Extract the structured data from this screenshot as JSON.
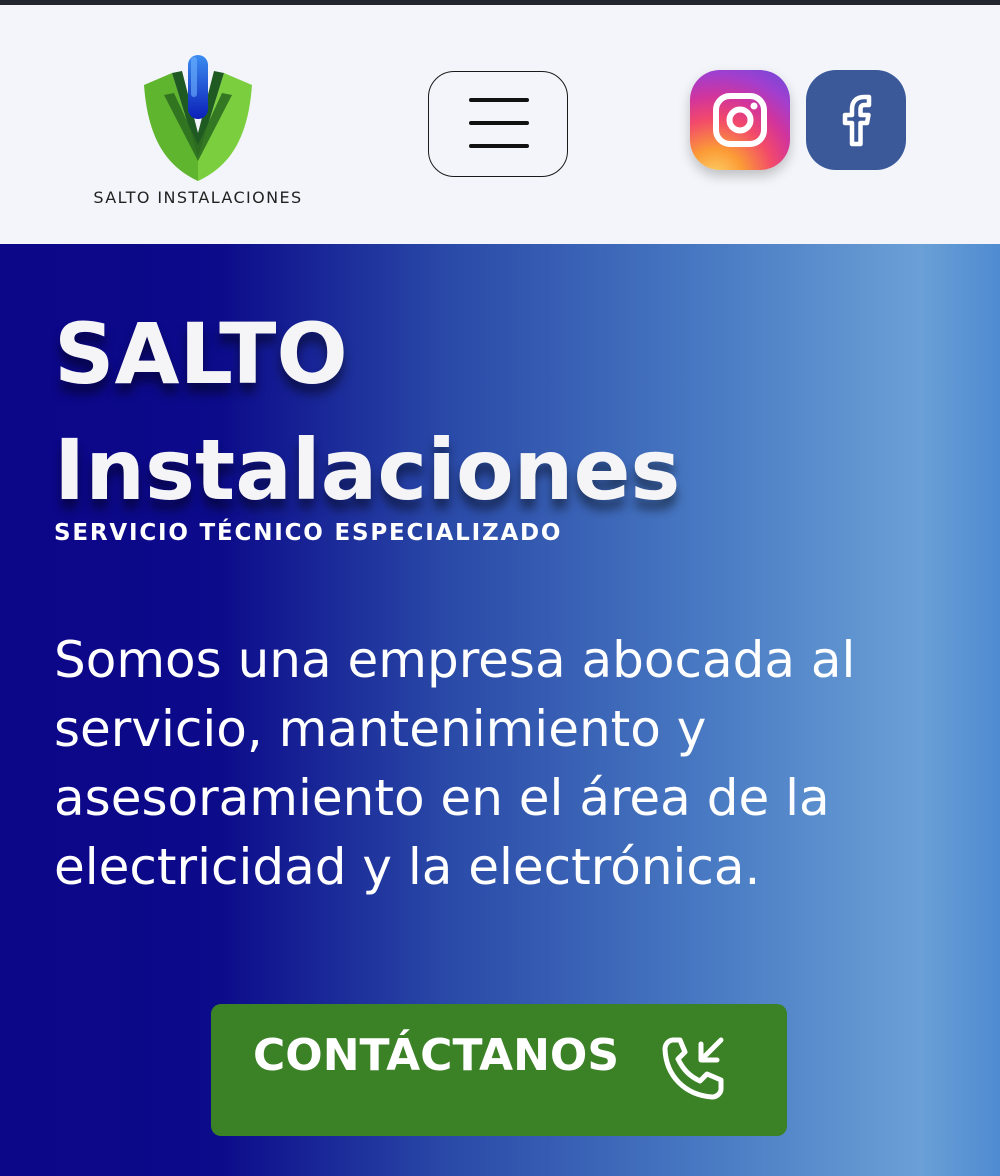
{
  "header": {
    "logo_text": "SALTO INSTALACIONES",
    "logo_icon": "shield-plug-icon",
    "menu_icon": "hamburger-menu-icon",
    "social": [
      {
        "name": "Instagram",
        "icon": "instagram-icon"
      },
      {
        "name": "Facebook",
        "icon": "facebook-icon"
      }
    ]
  },
  "hero": {
    "title_line1": "SALTO",
    "title_line2": "Instalaciones",
    "subtitle": "SERVICIO TÉCNICO ESPECIALIZADO",
    "description": "Somos una empresa abocada al servicio, mantenimiento y asesoramiento en el área de la electricidad y la electrónica.",
    "cta_label": "CONTÁCTANOS",
    "cta_icon": "phone-incoming-icon"
  },
  "colors": {
    "header_bg": "#f3f5fa",
    "hero_gradient_start": "#0c0688",
    "hero_gradient_end": "#6aa0d6",
    "cta_bg": "#3b8126",
    "logo_green": "#6cc23a",
    "logo_blue": "#1a3cd0",
    "facebook_blue": "#3b5998"
  }
}
